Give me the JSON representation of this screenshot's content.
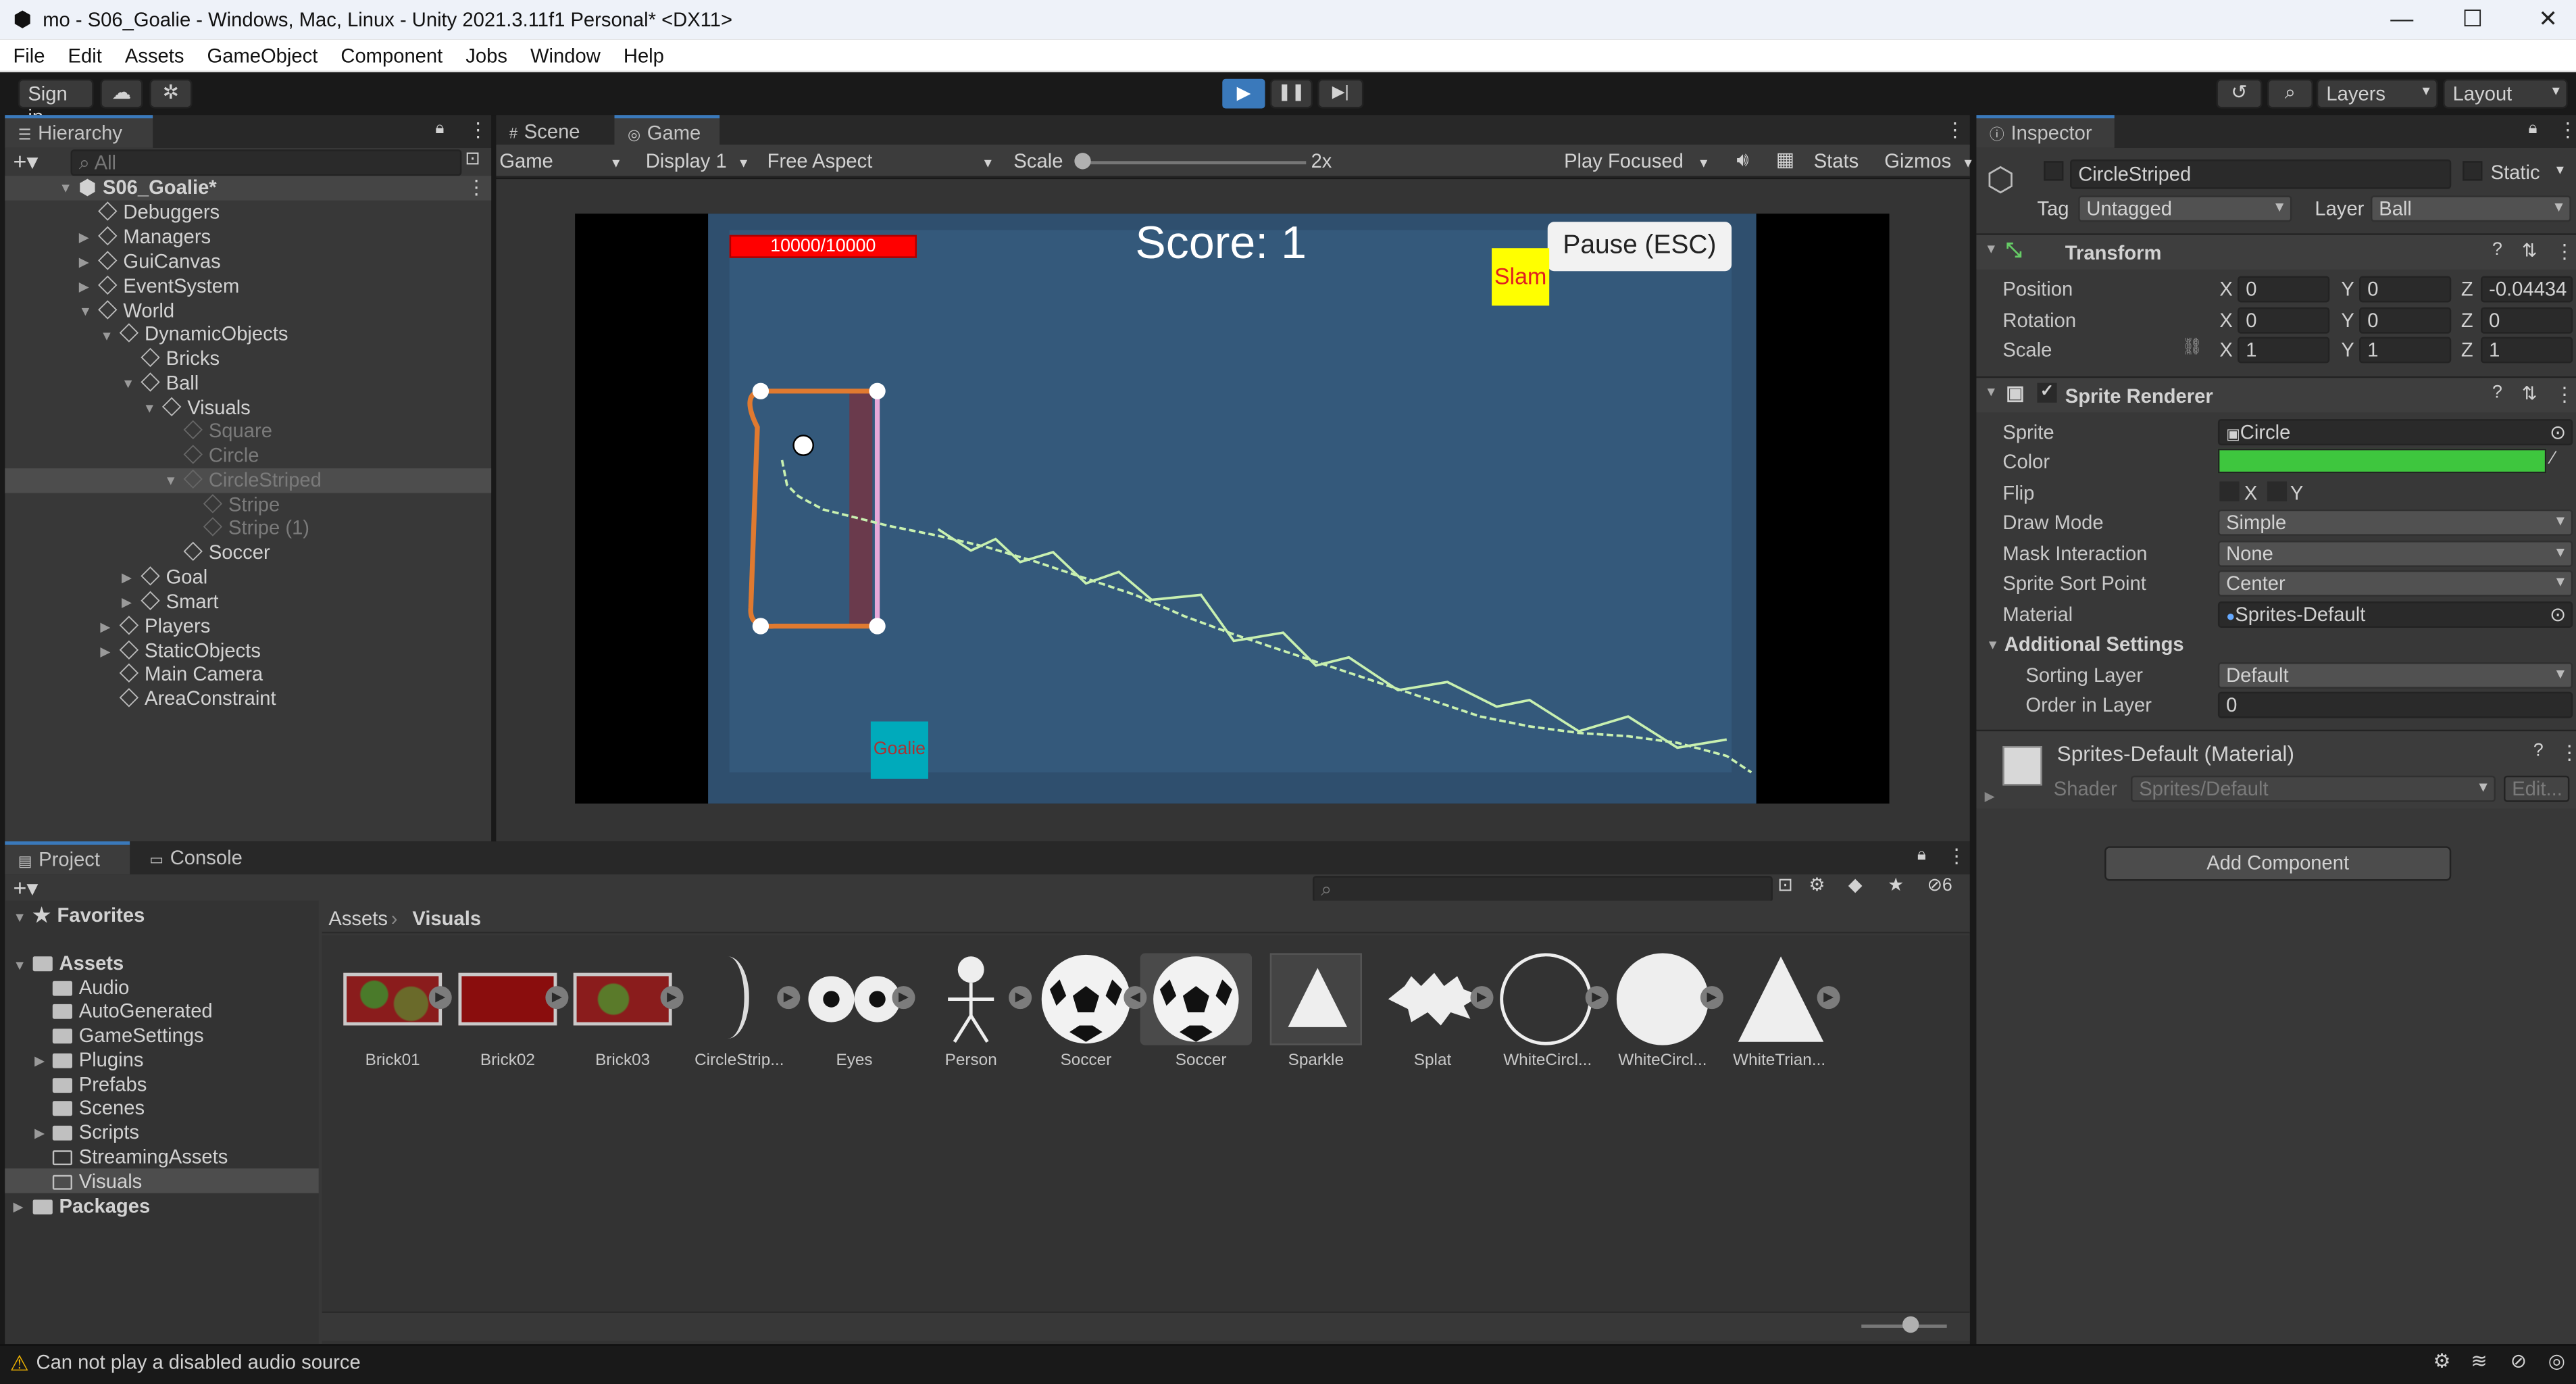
{
  "window": {
    "title": "mo - S06_Goalie - Windows, Mac, Linux - Unity 2021.3.11f1 Personal* <DX11>",
    "minimize": "—",
    "maximize": "☐",
    "close": "✕"
  },
  "menu": [
    "File",
    "Edit",
    "Assets",
    "GameObject",
    "Component",
    "Jobs",
    "Window",
    "Help"
  ],
  "toolbar": {
    "sign_in": "Sign in",
    "layers": "Layers",
    "layout": "Layout"
  },
  "hierarchy": {
    "tab": "Hierarchy",
    "search_placeholder": "All",
    "scene": "S06_Goalie*",
    "items": [
      "Debuggers",
      "Managers",
      "GuiCanvas",
      "EventSystem",
      "World",
      "DynamicObjects",
      "Bricks",
      "Ball",
      "Visuals",
      "Square",
      "Circle",
      "CircleStriped",
      "Stripe",
      "Stripe (1)",
      "Soccer",
      "Goal",
      "Smart",
      "Players",
      "StaticObjects",
      "Main Camera",
      "AreaConstraint"
    ]
  },
  "game_view": {
    "tabs": [
      "Scene",
      "Game"
    ],
    "controls": {
      "mode": "Game",
      "display": "Display 1",
      "aspect": "Free Aspect",
      "scale_label": "Scale",
      "scale_value": "2x",
      "play_focused": "Play Focused",
      "stats": "Stats",
      "gizmos": "Gizmos"
    },
    "hud": {
      "health": "10000/10000",
      "score": "Score: 1",
      "pause": "Pause (ESC)",
      "slam": "Slam",
      "goalie": "Goalie"
    },
    "colors": {
      "field": "#315370",
      "bars": "#000000",
      "health": "#ff0000",
      "slam": "#ffff00",
      "goalie": "#00aabb",
      "goal_frame": "#e07a30",
      "trail": "#c8f0b0"
    }
  },
  "project": {
    "tabs": [
      "Project",
      "Console"
    ],
    "favorites": "Favorites",
    "tree": [
      "Assets",
      "Audio",
      "AutoGenerated",
      "GameSettings",
      "Plugins",
      "Prefabs",
      "Scenes",
      "Scripts",
      "StreamingAssets",
      "Visuals",
      "Packages"
    ],
    "breadcrumb": [
      "Assets",
      "Visuals"
    ],
    "hidden_count": "6",
    "assets": [
      "Brick01",
      "Brick02",
      "Brick03",
      "CircleStrip...",
      "Eyes",
      "Person",
      "Soccer",
      "Soccer",
      "Sparkle",
      "Splat",
      "WhiteCircl...",
      "WhiteCircl...",
      "WhiteTrian..."
    ]
  },
  "inspector": {
    "tab": "Inspector",
    "name": "CircleStriped",
    "static": "Static",
    "tag_label": "Tag",
    "tag": "Untagged",
    "layer_label": "Layer",
    "layer": "Ball",
    "transform": {
      "title": "Transform",
      "position": {
        "label": "Position",
        "x": "0",
        "y": "0",
        "z": "-0.04434"
      },
      "rotation": {
        "label": "Rotation",
        "x": "0",
        "y": "0",
        "z": "0"
      },
      "scale": {
        "label": "Scale",
        "x": "1",
        "y": "1",
        "z": "1"
      }
    },
    "axis": {
      "x": "X",
      "y": "Y",
      "z": "Z"
    },
    "sprite_renderer": {
      "title": "Sprite Renderer",
      "sprite_label": "Sprite",
      "sprite": "Circle",
      "color_label": "Color",
      "color": "#3ec63e",
      "flip_label": "Flip",
      "flip_x": "X",
      "flip_y": "Y",
      "draw_mode_label": "Draw Mode",
      "draw_mode": "Simple",
      "mask_label": "Mask Interaction",
      "mask": "None",
      "sort_point_label": "Sprite Sort Point",
      "sort_point": "Center",
      "material_label": "Material",
      "material": "Sprites-Default",
      "additional": "Additional Settings",
      "sorting_layer_label": "Sorting Layer",
      "sorting_layer": "Default",
      "order_label": "Order in Layer",
      "order": "0"
    },
    "material": {
      "title": "Sprites-Default (Material)",
      "shader_label": "Shader",
      "shader": "Sprites/Default",
      "edit": "Edit..."
    },
    "add_component": "Add Component"
  },
  "status": {
    "message": "Can not play a disabled audio source"
  }
}
